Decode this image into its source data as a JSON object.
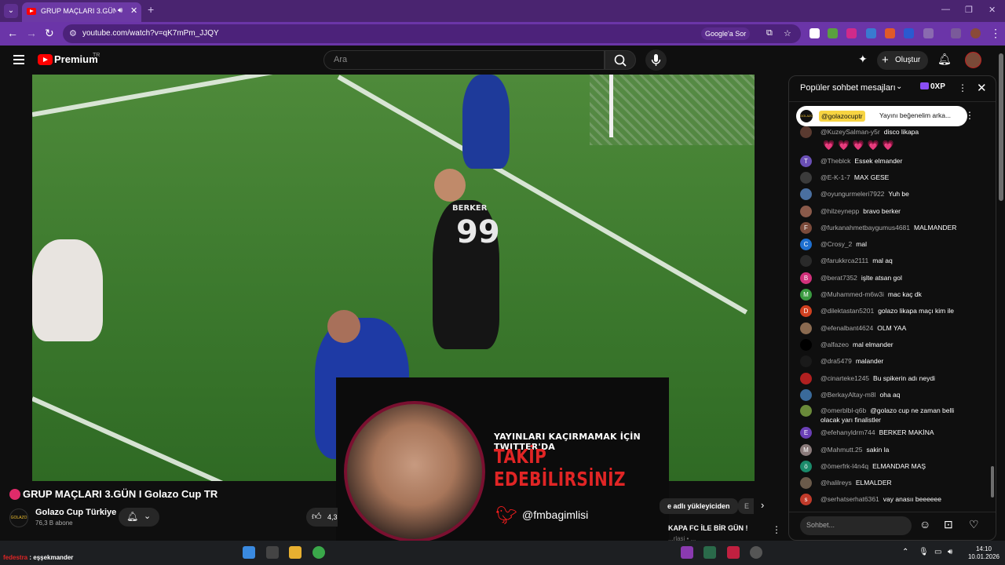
{
  "browser": {
    "tab_title": "GRUP MAÇLARI 3.GÜN I",
    "url": "youtube.com/watch?v=qK7mPm_JJQY",
    "google_sor": "Google'a Sor"
  },
  "youtube": {
    "logo": "Premium",
    "logo_region": "TR",
    "search_placeholder": "Ara",
    "create_label": "Oluştur"
  },
  "video": {
    "jersey_name": "BERKER",
    "jersey_number": "99",
    "title": "GRUP MAÇLARI 3.GÜN I Golazo Cup TR",
    "channel_name": "Golazo Cup Türkiye",
    "subscribers": "76,3 B abone",
    "like_count": "4,3"
  },
  "promo": {
    "line1": "YAYINLARI KAÇIRMAMAK İÇİN TWITTER'DA",
    "line2": "TAKİP EDEBİLİRSİNİZ",
    "handle": "@fmbagimlisi"
  },
  "recommendations": {
    "chip_label": "e adlı yükleyiciden",
    "chip2_label": "E",
    "rec_title": "KAPA FC İLE BİR GÜN !",
    "rec_sub": "...rlasi • ..."
  },
  "chat": {
    "title": "Popüler sohbet mesajları",
    "xp": "0XP",
    "pinned_author": "@golazocuptr",
    "pinned_text": "Yayını beğenelim arka...",
    "input_placeholder": "Sohbet...",
    "hearts": "💗💗💗💗💗",
    "messages": [
      {
        "author": "@KuzeySalman-y5r",
        "text": "disco likapa",
        "avatar": "",
        "avatar_color": "#5a3a30"
      },
      {
        "author": "@Theblck",
        "text": "Essek elmander",
        "avatar": "T",
        "avatar_color": "#6a4fb5"
      },
      {
        "author": "@E-K-1-7",
        "text": "MAX GESE",
        "avatar": "",
        "avatar_color": "#3b3b3b"
      },
      {
        "author": "@oyungurmeleri7922",
        "text": "Yuh be",
        "avatar": "",
        "avatar_color": "#4a6fa0"
      },
      {
        "author": "@hilzeynepp",
        "text": "bravo berker",
        "avatar": "",
        "avatar_color": "#8a5a4a"
      },
      {
        "author": "@furkanahmetbaygumus4681",
        "text": "MALMANDER",
        "avatar": "F",
        "avatar_color": "#7b4a3a"
      },
      {
        "author": "@Crosy_2",
        "text": "mal",
        "avatar": "C",
        "avatar_color": "#1e6fd0"
      },
      {
        "author": "@farukkrca2111",
        "text": "mal aq",
        "avatar": "",
        "avatar_color": "#2a2a2a"
      },
      {
        "author": "@berat7352",
        "text": "işlte atsan gol",
        "avatar": "B",
        "avatar_color": "#d0307a"
      },
      {
        "author": "@Muhammed-m6w3i",
        "text": "mac kaç dk",
        "avatar": "M",
        "avatar_color": "#3a9a40"
      },
      {
        "author": "@dilektastan5201",
        "text": "golazo likapa maçı kim ile",
        "avatar": "D",
        "avatar_color": "#d04020"
      },
      {
        "author": "@efenalbant4624",
        "text": "OLM YAA",
        "avatar": "",
        "avatar_color": "#8a6a50"
      },
      {
        "author": "@alfazeo",
        "text": "mal elmander",
        "avatar": "",
        "avatar_color": "#000000"
      },
      {
        "author": "@dra5479",
        "text": "malander",
        "avatar": "",
        "avatar_color": "#1a1a1a"
      },
      {
        "author": "@cinarteke1245",
        "text": "Bu spikerin adı neydi",
        "avatar": "",
        "avatar_color": "#b02020"
      },
      {
        "author": "@BerkayAltay-m8l",
        "text": "oha aq",
        "avatar": "",
        "avatar_color": "#3a6a9a"
      },
      {
        "author": "@omerblbl-q6b",
        "text": "@golazo cup ne zaman belli olacak yarı finalistler",
        "avatar": "",
        "avatar_color": "#6a8a3a"
      },
      {
        "author": "@efehanyldrm744",
        "text": "BERKER MAKİNA",
        "avatar": "E",
        "avatar_color": "#6a3fb5"
      },
      {
        "author": "@Mahmutt.25",
        "text": "sakin la",
        "avatar": "M",
        "avatar_color": "#8a7a7a"
      },
      {
        "author": "@ömerfrk-l4n4q",
        "text": "ELMANDAR MAŞ",
        "avatar": "ö",
        "avatar_color": "#1a8a6a"
      },
      {
        "author": "@halilreys",
        "text": "ELMALDER",
        "avatar": "",
        "avatar_color": "#6a5a4a"
      },
      {
        "author": "@serhatserhat6361",
        "text": "vay anasıı beeeeee",
        "avatar": "s",
        "avatar_color": "#c03a2a"
      }
    ]
  },
  "taskbar": {
    "chat_user": "fedestra",
    "chat_msg": ": eşşekmander",
    "time": "14:10",
    "date": "10.01.2026"
  }
}
